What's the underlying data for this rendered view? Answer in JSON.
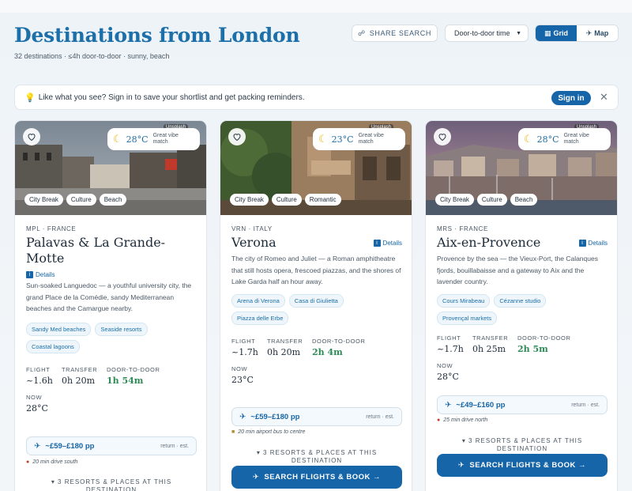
{
  "header": {
    "title": "Destinations from London",
    "subtitle": "32 destinations · ≤4h door-to-door · sunny, beach",
    "share_label": "SHARE SEARCH",
    "sort_value": "Door-to-door time",
    "grid_label": "Grid",
    "map_label": "Map"
  },
  "banner": {
    "text": "Like what you see? Sign in to save your shortlist and get packing reminders.",
    "signin_label": "Sign in",
    "close": "✕"
  },
  "labels": {
    "flight": "FLIGHT",
    "transfer": "TRANSFER",
    "door": "DOOR-TO-DOOR",
    "now": "NOW",
    "details": "Details",
    "unsplash": "Unsplash",
    "vibe": "Great vibe match",
    "price_note": "return · est.",
    "resorts": "▾ 3 RESORTS & PLACES AT THIS DESTINATION",
    "book": "SEARCH FLIGHTS & BOOK →"
  },
  "cards": [
    {
      "temp": "28°C",
      "tags": [
        "City Break",
        "Culture",
        "Beach"
      ],
      "code": "MPL · FRANCE",
      "name": "Palavas & La Grande-Motte",
      "desc": "Sun-soaked Languedoc — a youthful university city, the grand Place de la Comédie, sandy Mediterranean beaches and the Camargue nearby.",
      "chips": [
        "Sandy Med beaches",
        "Seaside resorts",
        "Coastal lagoons"
      ],
      "flight": "~1.6h",
      "transfer": "0h 20m",
      "door": "1h 54m",
      "now": "28°C",
      "price": "~£59–£180 pp",
      "drive": "20 min drive south"
    },
    {
      "temp": "23°C",
      "tags": [
        "City Break",
        "Culture",
        "Romantic"
      ],
      "code": "VRN · ITALY",
      "name": "Verona",
      "desc": "The city of Romeo and Juliet — a Roman amphitheatre that still hosts opera, frescoed piazzas, and the shores of Lake Garda half an hour away.",
      "chips": [
        "Arena di Verona",
        "Casa di Giulietta",
        "Piazza delle Erbe"
      ],
      "flight": "~1.7h",
      "transfer": "0h 20m",
      "door": "2h 4m",
      "now": "23°C",
      "price": "~£59–£180 pp",
      "drive": "20 min airport bus to centre"
    },
    {
      "temp": "28°C",
      "tags": [
        "City Break",
        "Culture",
        "Beach"
      ],
      "code": "MRS · FRANCE",
      "name": "Aix-en-Provence",
      "desc": "Provence by the sea — the Vieux-Port, the Calanques fjords, bouillabaisse and a gateway to Aix and the lavender country.",
      "chips": [
        "Cours Mirabeau",
        "Cézanne studio",
        "Provençal markets"
      ],
      "flight": "~1.7h",
      "transfer": "0h 25m",
      "door": "2h 5m",
      "now": "28°C",
      "price": "~£49–£160 pp",
      "drive": "25 min drive north"
    }
  ],
  "icons": {
    "share": "link-icon",
    "heart": "heart-icon",
    "moon": "moon-icon",
    "plane": "plane-icon",
    "car": "car-icon",
    "bus": "bus-icon",
    "bulb": "lightbulb-icon"
  },
  "colors": {
    "accent": "#1565a8",
    "title": "#1c6fa8",
    "green": "#2e8b57"
  }
}
